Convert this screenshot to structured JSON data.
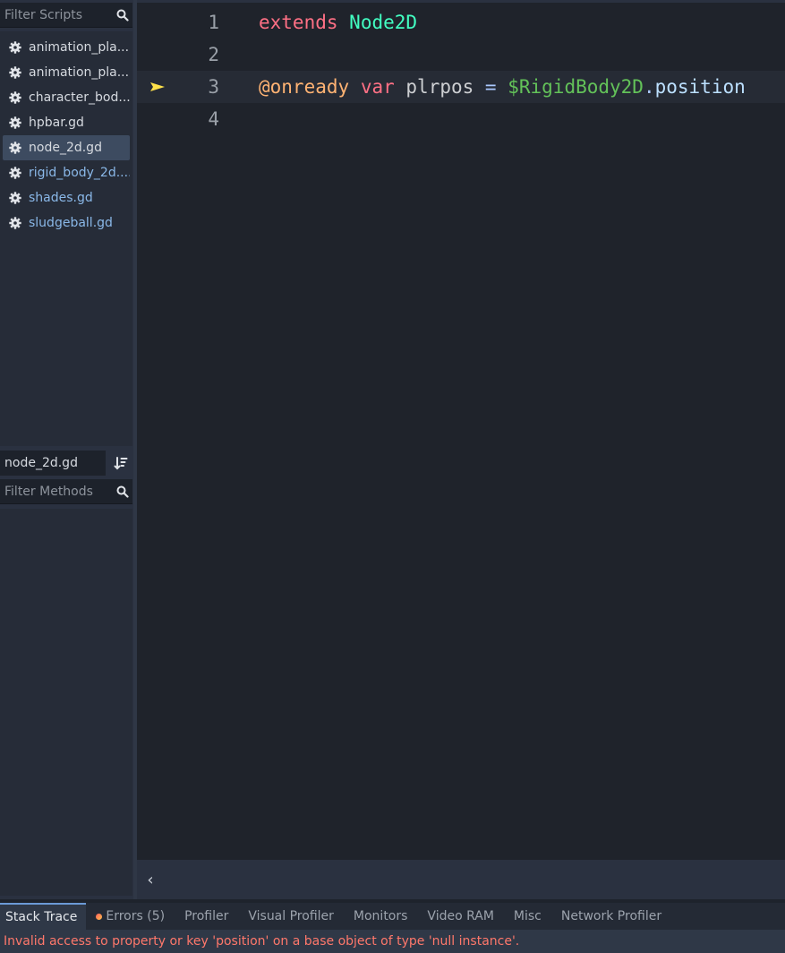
{
  "scripts_panel": {
    "filter_placeholder": "Filter Scripts",
    "items": [
      {
        "label": "animation_pla..."
      },
      {
        "label": "animation_pla..."
      },
      {
        "label": "character_bod..."
      },
      {
        "label": "hpbar.gd"
      },
      {
        "label": "node_2d.gd"
      },
      {
        "label": "rigid_body_2d...."
      },
      {
        "label": "shades.gd"
      },
      {
        "label": "sludgeball.gd"
      }
    ]
  },
  "methods_panel": {
    "current_file": "node_2d.gd",
    "filter_placeholder": "Filter Methods"
  },
  "editor": {
    "lines": [
      {
        "number": "1",
        "tokens": [
          "extends",
          " ",
          "Node2D"
        ]
      },
      {
        "number": "2"
      },
      {
        "number": "3",
        "tokens": [
          "@onready",
          " ",
          "var",
          " ",
          "plrpos",
          " ",
          "=",
          " ",
          "$RigidBody2D",
          ".",
          "position"
        ]
      },
      {
        "number": "4"
      }
    ]
  },
  "debugger": {
    "tabs": [
      {
        "label": "Stack Trace"
      },
      {
        "label": "Errors (5)"
      },
      {
        "label": "Profiler"
      },
      {
        "label": "Visual Profiler"
      },
      {
        "label": "Monitors"
      },
      {
        "label": "Video RAM"
      },
      {
        "label": "Misc"
      },
      {
        "label": "Network Profiler"
      }
    ],
    "error_message": "Invalid access to property or key 'position' on a base object of type 'null instance'."
  },
  "colors": {
    "keyword": "#ff7085",
    "type": "#42ffc2",
    "annotation": "#ffb373",
    "node_path": "#63c259",
    "error_text": "#ff786b",
    "selection": "#3d4b60",
    "exec_arrow": "#ffe14a"
  }
}
